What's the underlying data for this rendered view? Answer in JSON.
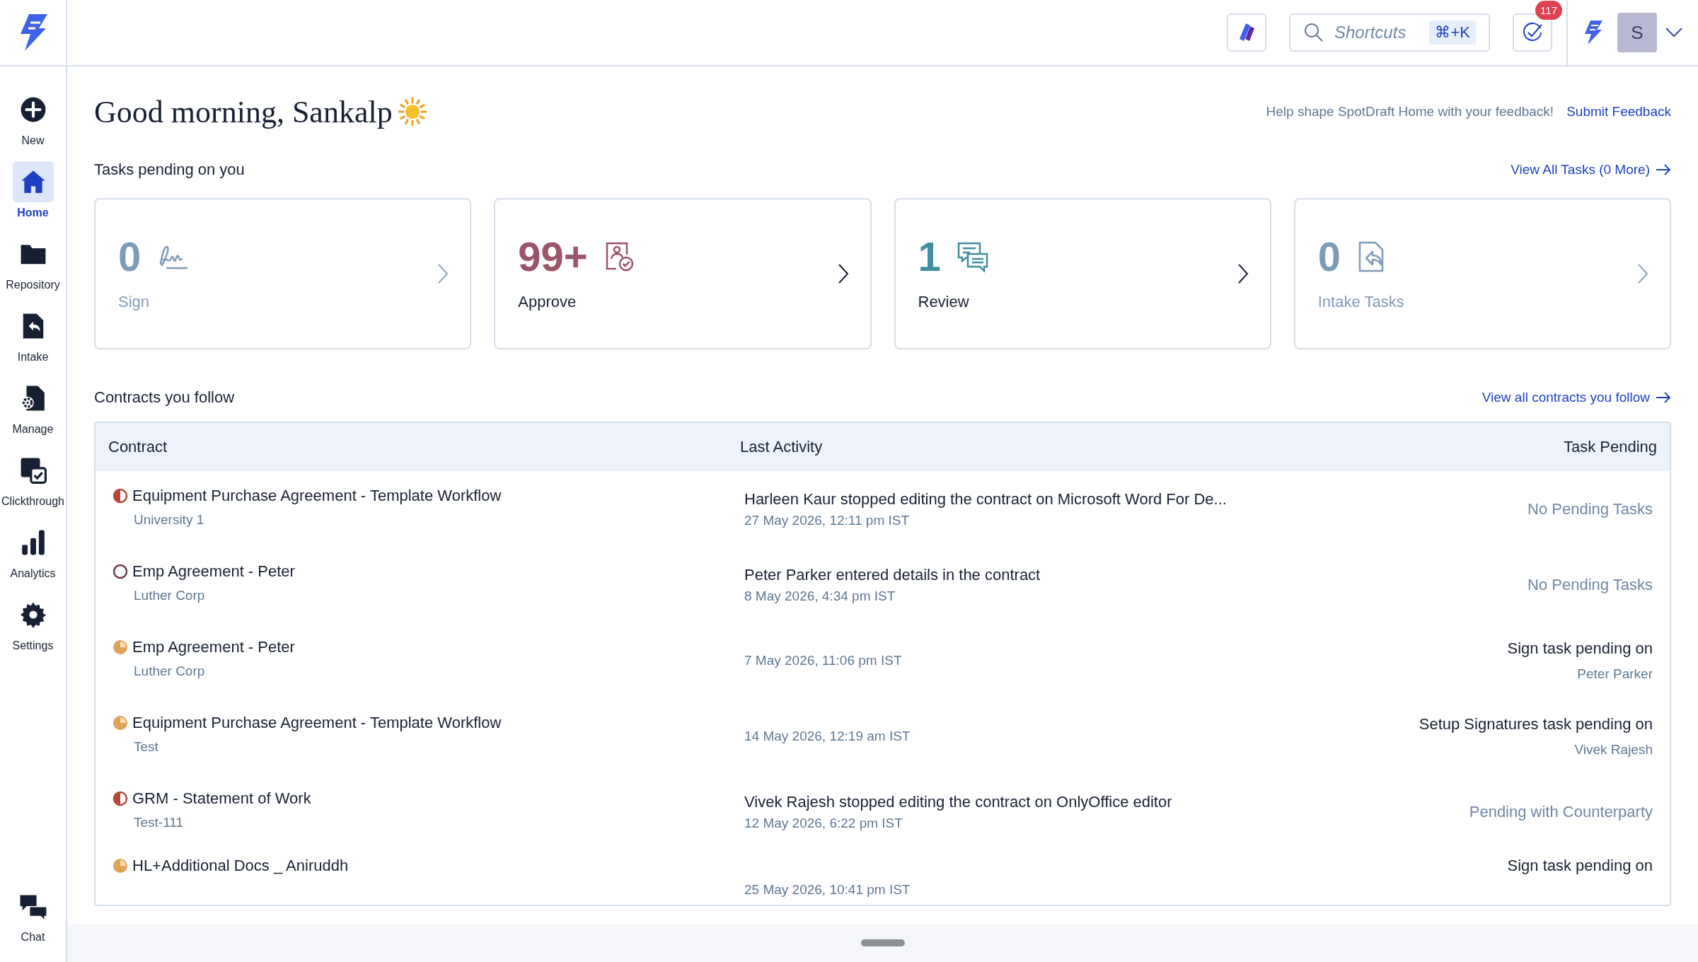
{
  "topbar": {
    "search": {
      "placeholder": "Shortcuts",
      "shortcut": "⌘+K"
    },
    "tasks_badge": "117",
    "avatar": "S"
  },
  "sidebar": {
    "items": [
      {
        "label": "New",
        "kind": "new",
        "selected": false
      },
      {
        "label": "Home",
        "kind": "home",
        "selected": true
      },
      {
        "label": "Repository",
        "kind": "folder",
        "selected": false
      },
      {
        "label": "Intake",
        "kind": "intake",
        "selected": false
      },
      {
        "label": "Manage",
        "kind": "manage",
        "selected": false
      },
      {
        "label": "Clickthrough",
        "kind": "clickthrough",
        "selected": false
      },
      {
        "label": "Analytics",
        "kind": "analytics",
        "selected": false
      },
      {
        "label": "Settings",
        "kind": "settings",
        "selected": false
      }
    ],
    "footer_items": [
      {
        "label": "Chat",
        "kind": "chat",
        "selected": false
      }
    ]
  },
  "greeting": "Good morning, Sankalp",
  "feedback": {
    "text": "Help shape SpotDraft Home with your feedback!",
    "link": "Submit Feedback"
  },
  "tasks": {
    "title": "Tasks pending on you",
    "link": "View All Tasks (0 More)",
    "cards": [
      {
        "count": "0",
        "label": "Sign",
        "kind": "sign",
        "disabled": true,
        "color": "#7f9bb8"
      },
      {
        "count": "99+",
        "label": "Approve",
        "kind": "approve",
        "disabled": false,
        "color": "#9c5468"
      },
      {
        "count": "1",
        "label": "Review",
        "kind": "review",
        "disabled": false,
        "color": "#3f8fa0"
      },
      {
        "count": "0",
        "label": "Intake Tasks",
        "kind": "intake",
        "disabled": true,
        "color": "#7f9bb8"
      }
    ]
  },
  "contracts": {
    "title": "Contracts you follow",
    "link": "View all contracts you follow",
    "columns": [
      "Contract",
      "Last Activity",
      "Task Pending"
    ],
    "rows": [
      {
        "kind": "half",
        "name": "Equipment Purchase Agreement - Template Workflow",
        "party": "University 1",
        "activity": "Harleen Kaur stopped editing the contract on Microsoft Word For De...",
        "time": "27 May 2026, 12:11 pm IST",
        "task": {
          "kind": "status",
          "text": "No Pending Tasks"
        }
      },
      {
        "kind": "empty",
        "name": "Emp Agreement - Peter",
        "party": "Luther Corp",
        "activity": "Peter Parker entered details in the contract",
        "time": "8 May 2026, 4:34 pm IST",
        "task": {
          "kind": "status",
          "text": "No Pending Tasks"
        }
      },
      {
        "kind": "quarter",
        "name": "Emp Agreement - Peter",
        "party": "Luther Corp",
        "time": "7 May 2026, 11:06 pm IST",
        "task": {
          "kind": "assigned",
          "text": "Sign task pending on",
          "assignee": "Peter Parker"
        }
      },
      {
        "kind": "quarter",
        "name": "Equipment Purchase Agreement - Template Workflow",
        "party": "Test",
        "time": "14 May 2026, 12:19 am IST",
        "task": {
          "kind": "assigned",
          "text": "Setup Signatures task pending on",
          "assignee": "Vivek Rajesh"
        }
      },
      {
        "kind": "half",
        "name": "GRM - Statement of Work",
        "party": "Test-111",
        "activity": "Vivek Rajesh stopped editing the contract on OnlyOffice editor",
        "time": "12 May 2026, 6:22 pm IST",
        "task": {
          "kind": "status",
          "text": "Pending with Counterparty"
        }
      },
      {
        "kind": "quarter",
        "name": "HL+Additional Docs _ Aniruddh",
        "time": "25 May 2026, 10:41 pm IST",
        "task": {
          "kind": "assigned",
          "text": "Sign task pending on"
        }
      }
    ]
  }
}
